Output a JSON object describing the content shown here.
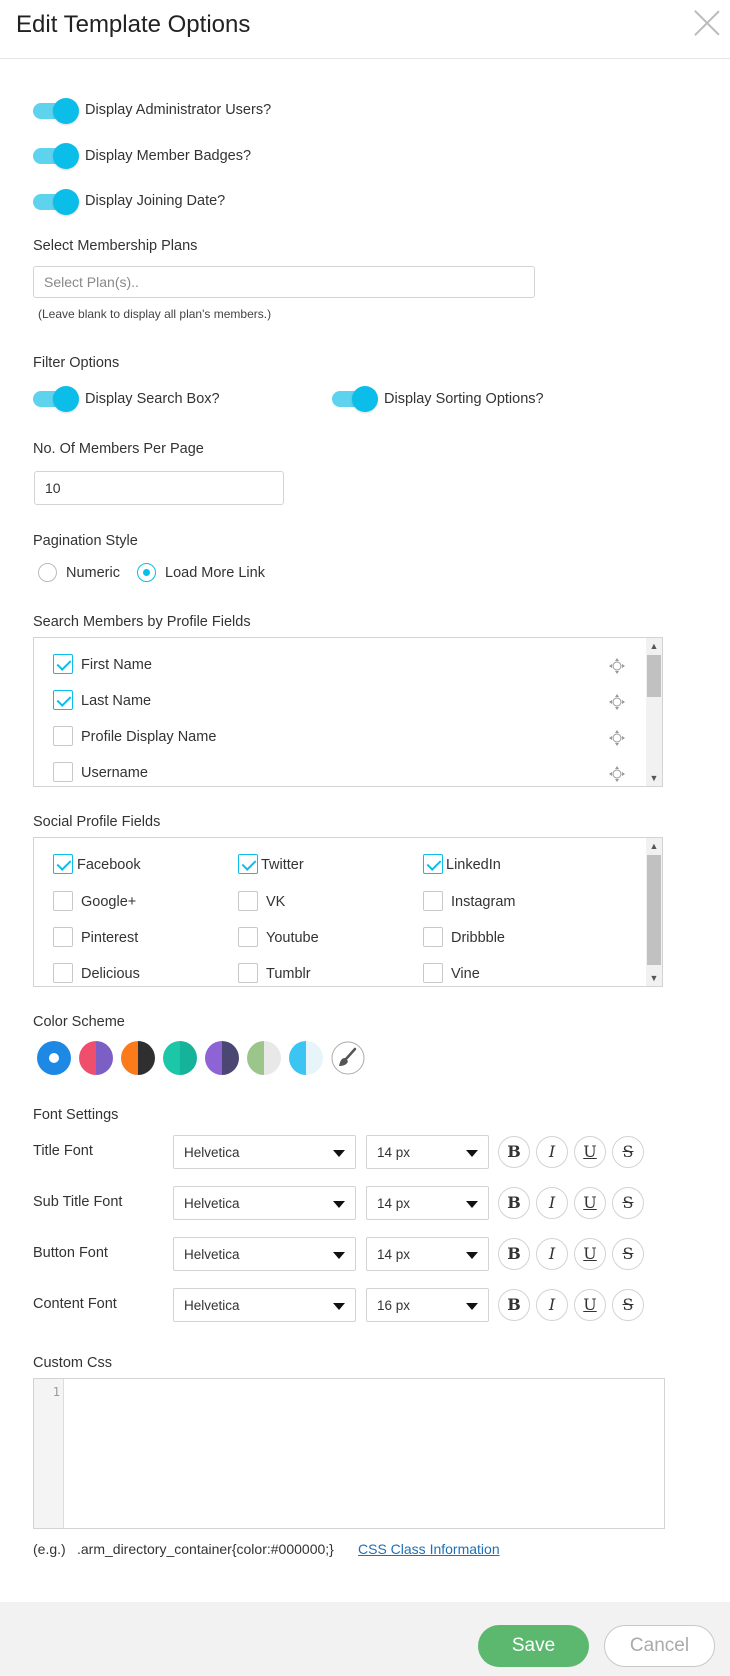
{
  "header": {
    "title": "Edit Template Options"
  },
  "toggles": [
    {
      "label": "Display Administrator Users?",
      "on": true
    },
    {
      "label": "Display Member Badges?",
      "on": true
    },
    {
      "label": "Display Joining Date?",
      "on": true
    }
  ],
  "membership": {
    "label": "Select Membership Plans",
    "placeholder": "Select Plan(s)..",
    "hint": "(Leave blank to display all plan's members.)"
  },
  "filter": {
    "label": "Filter Options",
    "search_box": "Display Search Box?",
    "sorting": "Display Sorting Options?"
  },
  "per_page": {
    "label": "No. Of Members Per Page",
    "value": "10"
  },
  "pagination": {
    "label": "Pagination Style",
    "options": [
      "Numeric",
      "Load More Link"
    ],
    "selected": "Load More Link"
  },
  "profile_fields": {
    "label": "Search Members by Profile Fields",
    "items": [
      {
        "label": "First Name",
        "checked": true
      },
      {
        "label": "Last Name",
        "checked": true
      },
      {
        "label": "Profile Display Name",
        "checked": false
      },
      {
        "label": "Username",
        "checked": false
      }
    ]
  },
  "social_fields": {
    "label": "Social Profile Fields",
    "items": [
      {
        "label": "Facebook",
        "checked": true
      },
      {
        "label": "Twitter",
        "checked": true
      },
      {
        "label": "LinkedIn",
        "checked": true
      },
      {
        "label": "Google+",
        "checked": false
      },
      {
        "label": "VK",
        "checked": false
      },
      {
        "label": "Instagram",
        "checked": false
      },
      {
        "label": "Pinterest",
        "checked": false
      },
      {
        "label": "Youtube",
        "checked": false
      },
      {
        "label": "Dribbble",
        "checked": false
      },
      {
        "label": "Delicious",
        "checked": false
      },
      {
        "label": "Tumblr",
        "checked": false
      },
      {
        "label": "Vine",
        "checked": false
      }
    ]
  },
  "color_scheme": {
    "label": "Color Scheme",
    "swatches": [
      {
        "left": "#1e88e5",
        "right": "#1e88e5",
        "selected": true
      },
      {
        "left": "#ef4f6c",
        "right": "#7b5fc4",
        "selected": false
      },
      {
        "left": "#fb7a1a",
        "right": "#2f2f2f",
        "selected": false
      },
      {
        "left": "#1cc7a8",
        "right": "#15b39a",
        "selected": false
      },
      {
        "left": "#8d63d6",
        "right": "#4a4872",
        "selected": false
      },
      {
        "left": "#9bc58b",
        "right": "#e8e8e8",
        "selected": false
      },
      {
        "left": "#3cc4f3",
        "right": "#e7f5fb",
        "selected": false
      }
    ]
  },
  "fonts": {
    "label": "Font Settings",
    "rows": [
      {
        "label": "Title Font",
        "family": "Helvetica",
        "size": "14 px"
      },
      {
        "label": "Sub Title Font",
        "family": "Helvetica",
        "size": "14 px"
      },
      {
        "label": "Button Font",
        "family": "Helvetica",
        "size": "14 px"
      },
      {
        "label": "Content Font",
        "family": "Helvetica",
        "size": "16 px"
      }
    ],
    "format_buttons": [
      "B",
      "I",
      "U",
      "S"
    ]
  },
  "custom_css": {
    "label": "Custom Css",
    "line_number": "1",
    "example_prefix": "(e.g.)",
    "example_code": ".arm_directory_container{color:#000000;}",
    "link": "CSS Class Information"
  },
  "footer": {
    "save": "Save",
    "cancel": "Cancel"
  }
}
